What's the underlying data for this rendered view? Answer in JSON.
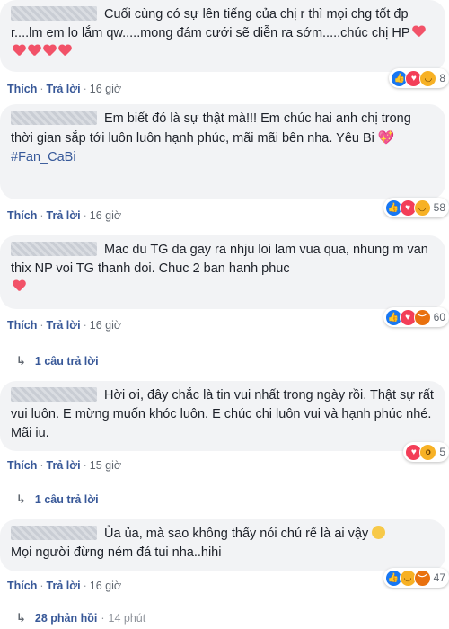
{
  "comments": [
    {
      "text": "Cuối cùng có sự lên tiếng của chị r thì mọi chg tốt đp r....lm em lo lắm qw.....mong đám cưới sẽ diễn ra sớm.....chúc chị HP",
      "like": "Thích",
      "reply": "Trả lời",
      "time": "16 giờ",
      "count": "8"
    },
    {
      "text": "Em biết đó là sự thật mà!!! Em chúc hai anh chị trong thời gian sắp tới luôn luôn hạnh phúc, mãi mãi bên nha. Yêu Bi",
      "hashtag": "#Fan_CaBi",
      "like": "Thích",
      "reply": "Trả lời",
      "time": "16 giờ",
      "count": "58"
    },
    {
      "text": "Mac du TG da gay ra nhju loi lam vua qua, nhung m van thix NP voi TG thanh doi. Chuc 2 ban hanh phuc",
      "like": "Thích",
      "reply": "Trả lời",
      "time": "16 giờ",
      "count": "60",
      "replies": "1 câu trả lời"
    },
    {
      "text": "Hời ơi, đây chắc là tin vui nhất trong ngày rồi. Thật sự rất vui luôn. E mừng muốn khóc luôn. E chúc chi luôn vui và hạnh phúc nhé. Mãi iu.",
      "like": "Thích",
      "reply": "Trả lời",
      "time": "15 giờ",
      "count": "5",
      "replies": "1 câu trả lời"
    },
    {
      "text": "Ủa ủa, mà sao không thấy nói chú rể là ai vậy",
      "text2": "Mọi người đừng ném đá tui nha..hihi",
      "like": "Thích",
      "reply": "Trả lời",
      "time": "16 giờ",
      "count": "47"
    }
  ],
  "footer": {
    "replies": "28 phản hồi",
    "time": "14 phút"
  },
  "colors": {
    "link": "#385898",
    "bubble": "#f2f3f5",
    "heart": "#f25268"
  }
}
